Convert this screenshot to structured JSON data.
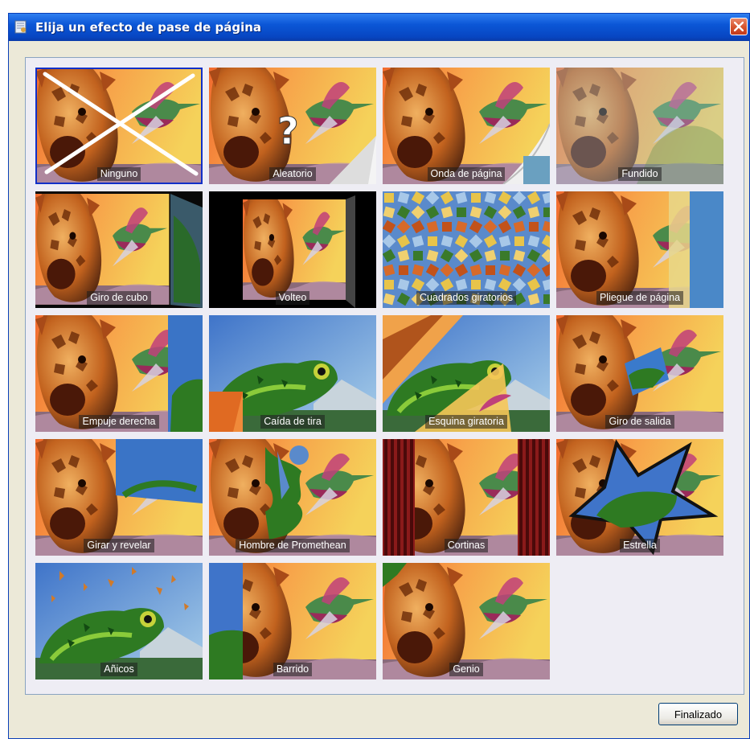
{
  "window": {
    "title": "Elija un efecto de pase de página"
  },
  "effects": [
    {
      "label": "Ninguno",
      "selected": true
    },
    {
      "label": "Aleatorio"
    },
    {
      "label": "Onda de página"
    },
    {
      "label": "Fundido"
    },
    {
      "label": "Giro de cubo"
    },
    {
      "label": "Volteo"
    },
    {
      "label": "Cuadrados giratorios"
    },
    {
      "label": "Pliegue de página"
    },
    {
      "label": "Empuje derecha"
    },
    {
      "label": "Caída de tira"
    },
    {
      "label": "Esquina giratoria"
    },
    {
      "label": "Giro de salida"
    },
    {
      "label": "Girar y revelar"
    },
    {
      "label": "Hombre de Promethean"
    },
    {
      "label": "Cortinas"
    },
    {
      "label": "Estrella"
    },
    {
      "label": "Añicos"
    },
    {
      "label": "Barrido"
    },
    {
      "label": "Genio"
    }
  ],
  "footer": {
    "done_label": "Finalizado"
  },
  "colors": {
    "titlebar": "#0b56d6",
    "selection_border": "#1230c8",
    "window_bg": "#ece9d8"
  }
}
